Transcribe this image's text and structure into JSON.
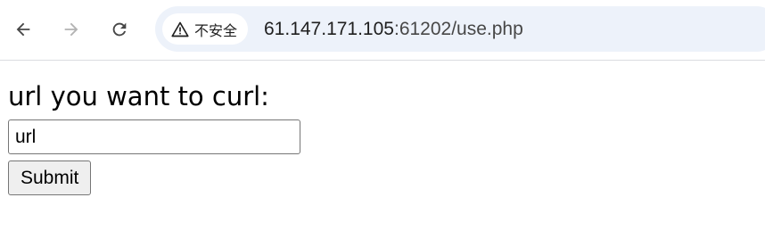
{
  "browser": {
    "security_label": "不安全",
    "url_host": "61.147.171.105",
    "url_rest": ":61202/use.php",
    "icons": {
      "back": "back-arrow-icon",
      "forward": "forward-arrow-icon",
      "reload": "reload-icon",
      "warning": "warning-triangle-icon"
    }
  },
  "form": {
    "prompt": "url you want to curl:",
    "input_value": "url",
    "submit_label": "Submit"
  }
}
